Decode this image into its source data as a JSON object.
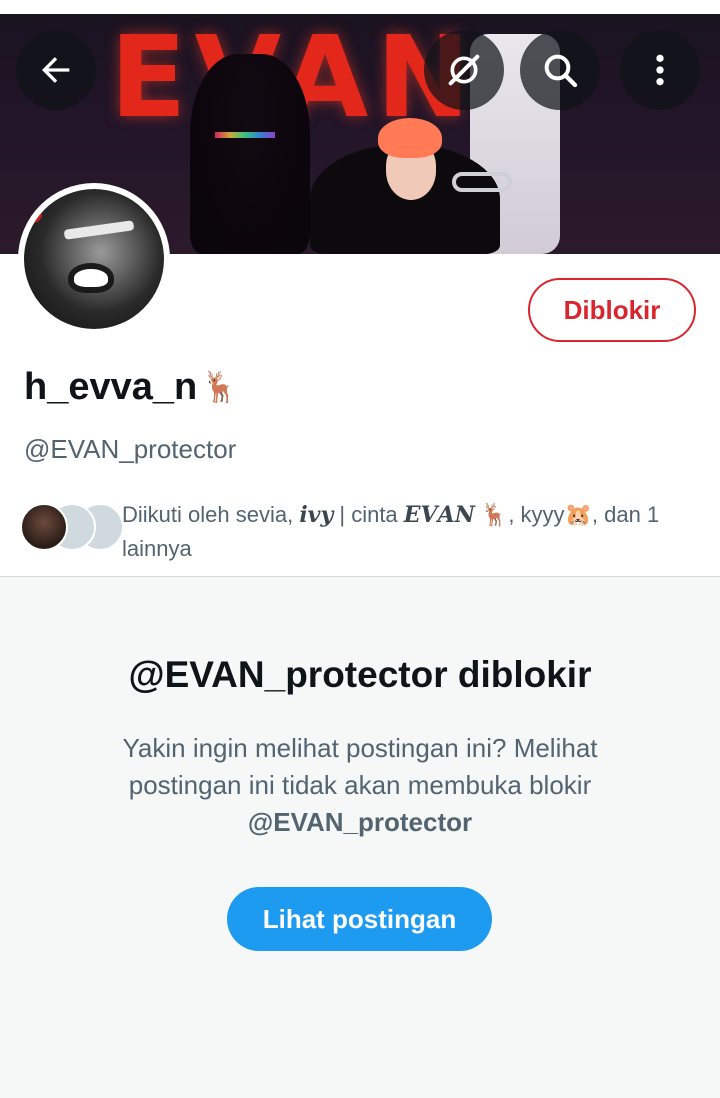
{
  "header": {
    "banner_text": "EVAN",
    "back_icon": "arrow-left-icon",
    "grok_icon": "grok-icon",
    "search_icon": "search-icon",
    "more_icon": "more-vertical-icon"
  },
  "profile": {
    "display_name": "h_evva_n",
    "display_name_emoji": "🦌",
    "handle": "@EVAN_protector",
    "blocked_button_label": "Diblokir",
    "followed_by": {
      "prefix": "Diikuti oleh sevia, ",
      "ivy": "𝒊𝒗𝒚",
      "mid": " | cinta ",
      "evan": "𝑬𝑽𝑨𝑵",
      "after_evan": " 🦌, kyyy🐹, dan 1 lainnya"
    }
  },
  "blocked_notice": {
    "title": "@EVAN_protector diblokir",
    "description": "Yakin ingin melihat postingan ini? Melihat postingan ini tidak akan membuka blokir",
    "description_handle": "@EVAN_protector",
    "view_button_label": "Lihat postingan"
  },
  "colors": {
    "accent": "#1d9bf0",
    "blocked_red": "#d9262e",
    "secondary_text": "#536471",
    "panel_bg": "#f6f7f7"
  }
}
